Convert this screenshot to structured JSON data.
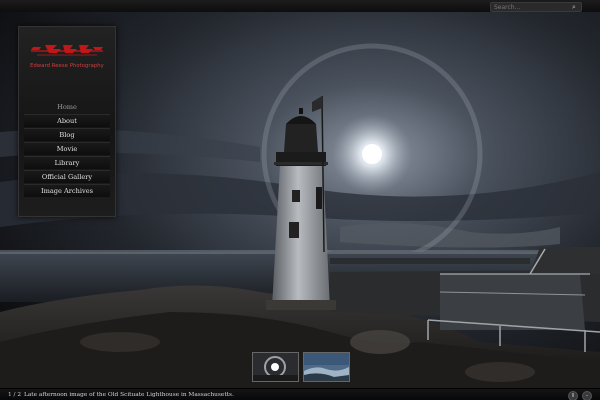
{
  "search": {
    "placeholder": "Search...",
    "icon": "search-icon"
  },
  "brand": {
    "subtitle": "Edward Reese Photography",
    "logo_color": "#c01818"
  },
  "nav": {
    "items": [
      {
        "label": "Home",
        "active": true
      },
      {
        "label": "About"
      },
      {
        "label": "Blog"
      },
      {
        "label": "Movie"
      },
      {
        "label": "Library"
      },
      {
        "label": "Official Gallery"
      },
      {
        "label": "Image Archives"
      }
    ]
  },
  "slideshow": {
    "counter": "1 / 2",
    "caption": "Late afternoon image of the Old Scituate Lighthouse in Massachusetts.",
    "controls": {
      "pause_icon": "pause-icon",
      "minimize_icon": "minimize-icon",
      "pause_glyph": "II",
      "minimize_glyph": "–"
    }
  },
  "thumbnails": [
    {
      "name": "thumbnail-halo"
    },
    {
      "name": "thumbnail-coast"
    }
  ]
}
